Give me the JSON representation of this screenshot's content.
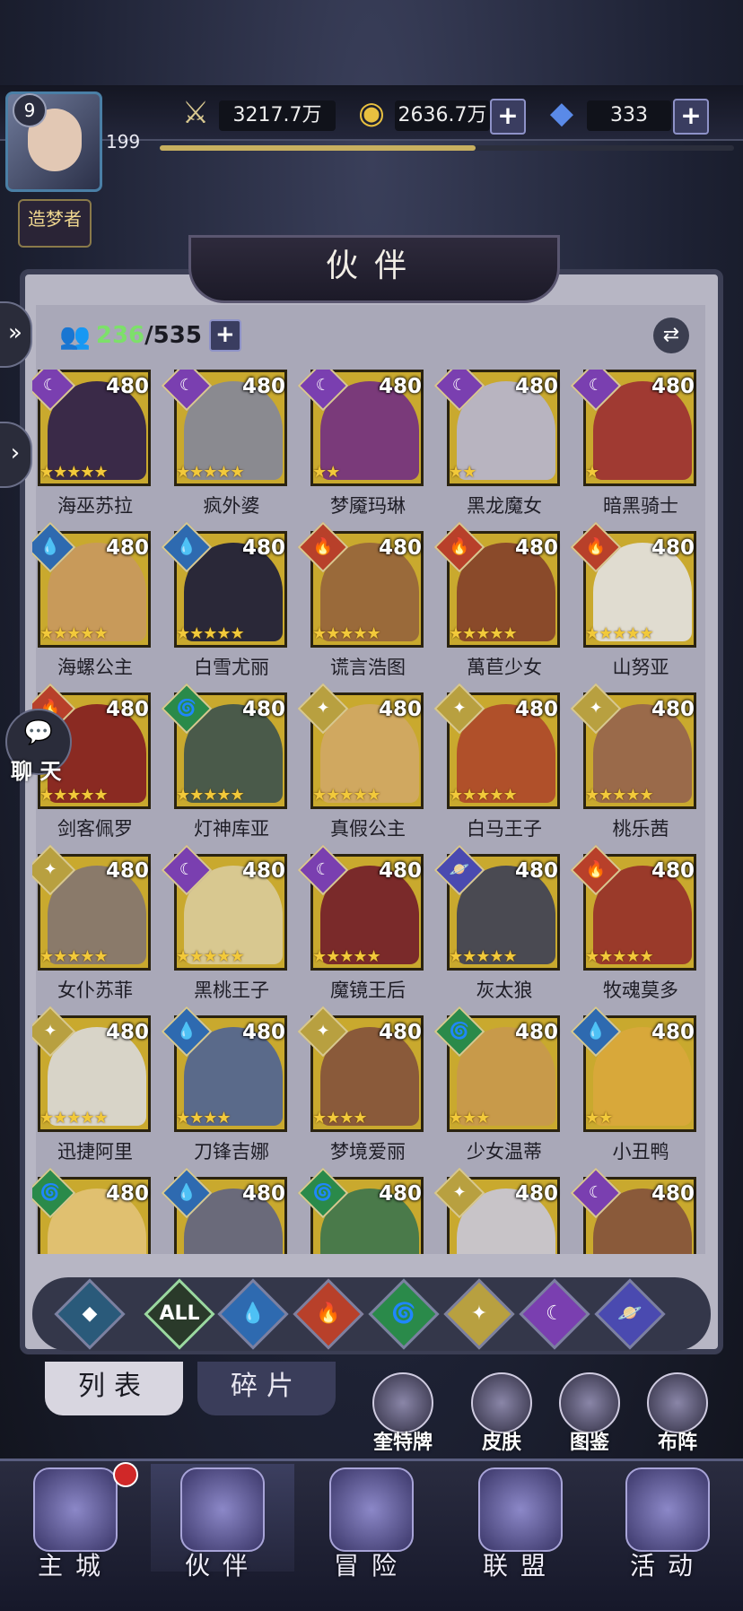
{
  "player": {
    "level": "9",
    "vip": "199",
    "title": "造梦者"
  },
  "resources": {
    "power": "3217.7万",
    "gold": "2636.7万",
    "diamond": "333",
    "exp_fraction": 0.55
  },
  "page_title": "伙伴",
  "roster": {
    "owned": "236",
    "total": "/535"
  },
  "heroes": [
    {
      "name": "海巫苏拉",
      "level": "480",
      "stars": "★★★★★",
      "element": "☾",
      "el_color": "#7a3fb0",
      "art": "#3a2a48"
    },
    {
      "name": "疯外婆",
      "level": "480",
      "stars": "★★★★★",
      "element": "☾",
      "el_color": "#7a3fb0",
      "art": "#8a8a90"
    },
    {
      "name": "梦魇玛琳",
      "level": "480",
      "stars": "★★",
      "element": "☾",
      "el_color": "#7a3fb0",
      "art": "#7a3a7a"
    },
    {
      "name": "黑龙魔女",
      "level": "480",
      "stars": "★★",
      "element": "☾",
      "el_color": "#7a3fb0",
      "art": "#b8b4c0"
    },
    {
      "name": "暗黑骑士",
      "level": "480",
      "stars": "★",
      "element": "☾",
      "el_color": "#7a3fb0",
      "art": "#a03a32"
    },
    {
      "name": "海螺公主",
      "level": "480",
      "stars": "★★★★★",
      "element": "💧",
      "el_color": "#2e6ab0",
      "art": "#c89a5a"
    },
    {
      "name": "白雪尤丽",
      "level": "480",
      "stars": "★★★★★",
      "element": "💧",
      "el_color": "#2e6ab0",
      "art": "#2a2838"
    },
    {
      "name": "谎言浩图",
      "level": "480",
      "stars": "★★★★★",
      "element": "🔥",
      "el_color": "#b8402a",
      "art": "#9a6a3a"
    },
    {
      "name": "萬苣少女",
      "level": "480",
      "stars": "★★★★★",
      "element": "🔥",
      "el_color": "#b8402a",
      "art": "#8a4a2a"
    },
    {
      "name": "山努亚",
      "level": "480",
      "stars": "★★★★★",
      "element": "🔥",
      "el_color": "#b8402a",
      "art": "#e0dcd0"
    },
    {
      "name": "剑客佩罗",
      "level": "480",
      "stars": "★★★★★",
      "element": "🔥",
      "el_color": "#b8402a",
      "art": "#8a2a22"
    },
    {
      "name": "灯神库亚",
      "level": "480",
      "stars": "★★★★★",
      "element": "🌀",
      "el_color": "#2a8a4a",
      "art": "#4a5a4a"
    },
    {
      "name": "真假公主",
      "level": "480",
      "stars": "★★★★★",
      "element": "✦",
      "el_color": "#b8a040",
      "art": "#d0a860"
    },
    {
      "name": "白马王子",
      "level": "480",
      "stars": "★★★★★",
      "element": "✦",
      "el_color": "#b8a040",
      "art": "#b0502a"
    },
    {
      "name": "桃乐茜",
      "level": "480",
      "stars": "★★★★★",
      "element": "✦",
      "el_color": "#b8a040",
      "art": "#9a6a4a"
    },
    {
      "name": "女仆苏菲",
      "level": "480",
      "stars": "★★★★★",
      "element": "✦",
      "el_color": "#b8a040",
      "art": "#8a7a6a"
    },
    {
      "name": "黑桃王子",
      "level": "480",
      "stars": "★★★★★",
      "element": "☾",
      "el_color": "#7a3fb0",
      "art": "#d8c890"
    },
    {
      "name": "魔镜王后",
      "level": "480",
      "stars": "★★★★★",
      "element": "☾",
      "el_color": "#7a3fb0",
      "art": "#7a2a2a"
    },
    {
      "name": "灰太狼",
      "level": "480",
      "stars": "★★★★★",
      "element": "🪐",
      "el_color": "#4a4ab0",
      "art": "#4a4a52"
    },
    {
      "name": "牧魂莫多",
      "level": "480",
      "stars": "★★★★★",
      "element": "🔥",
      "el_color": "#b8402a",
      "art": "#9a3a2a"
    },
    {
      "name": "迅捷阿里",
      "level": "480",
      "stars": "★★★★★",
      "element": "✦",
      "el_color": "#b8a040",
      "art": "#d8d4c8"
    },
    {
      "name": "刀锋吉娜",
      "level": "480",
      "stars": "★★★★",
      "element": "💧",
      "el_color": "#2e6ab0",
      "art": "#5a6a8a"
    },
    {
      "name": "梦境爱丽",
      "level": "480",
      "stars": "★★★★",
      "element": "✦",
      "el_color": "#b8a040",
      "art": "#8a5a3a"
    },
    {
      "name": "少女温蒂",
      "level": "480",
      "stars": "★★★",
      "element": "🌀",
      "el_color": "#2a8a4a",
      "art": "#c89a4a"
    },
    {
      "name": "小丑鸭",
      "level": "480",
      "stars": "★★",
      "element": "💧",
      "el_color": "#2e6ab0",
      "art": "#d8a83a"
    },
    {
      "name": "",
      "level": "480",
      "stars": "",
      "element": "🌀",
      "el_color": "#2a8a4a",
      "art": "#e0c070"
    },
    {
      "name": "",
      "level": "480",
      "stars": "",
      "element": "💧",
      "el_color": "#2e6ab0",
      "art": "#6a6a7a"
    },
    {
      "name": "",
      "level": "480",
      "stars": "",
      "element": "🌀",
      "el_color": "#2a8a4a",
      "art": "#4a7a4a"
    },
    {
      "name": "",
      "level": "480",
      "stars": "",
      "element": "✦",
      "el_color": "#b8a040",
      "art": "#c8c4c8"
    },
    {
      "name": "",
      "level": "480",
      "stars": "",
      "element": "☾",
      "el_color": "#7a3fb0",
      "art": "#8a5a3a"
    }
  ],
  "filters": [
    {
      "icon": "◆",
      "color": "#2a5a7a"
    },
    {
      "icon": "ALL",
      "color": "#2a3a2a"
    },
    {
      "icon": "💧",
      "color": "#2e6ab0"
    },
    {
      "icon": "🔥",
      "color": "#b8402a"
    },
    {
      "icon": "🌀",
      "color": "#2a8a4a"
    },
    {
      "icon": "✦",
      "color": "#b8a040"
    },
    {
      "icon": "☾",
      "color": "#7a3fb0"
    },
    {
      "icon": "🪐",
      "color": "#4a4ab0"
    }
  ],
  "tabs": {
    "list": "列表",
    "fragments": "碎片"
  },
  "sub_buttons": [
    "奎特牌",
    "皮肤",
    "图鉴",
    "布阵"
  ],
  "chat": {
    "label": "聊 天"
  },
  "nav": [
    "主城",
    "伙伴",
    "冒险",
    "联盟",
    "活动"
  ]
}
